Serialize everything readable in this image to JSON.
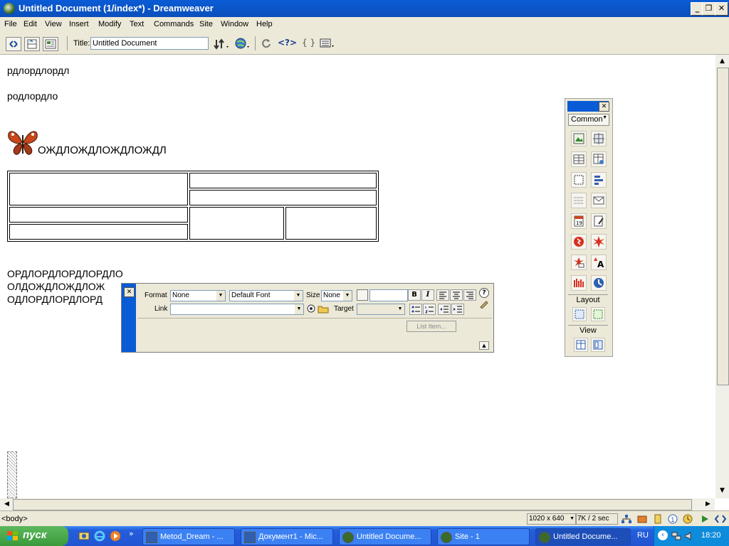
{
  "window": {
    "title": "Untitled Document (1/index*) - Dreamweaver",
    "minimize": "_",
    "restore": "❐",
    "close": "✕"
  },
  "menu": [
    "File",
    "Edit",
    "View",
    "Insert",
    "Modify",
    "Text",
    "Commands",
    "Site",
    "Window",
    "Help"
  ],
  "toolbar": {
    "title_label": "Title:",
    "title_value": "Untitled Document",
    "code_glyph": "<?>",
    "braces_glyph": "{ }"
  },
  "document": {
    "para1": "рдлордлордл",
    "para2": "родлордло",
    "heading_text": "ОЖДЛОЖДЛОЖДЛОЖДЛ",
    "para3": "ОРДЛОРДЛОРДЛОРДЛО",
    "para4": "ОЛДОЖДЛОЖДЛОЖ",
    "para5": "ОДЛОРДЛОРДЛОРД"
  },
  "objects_panel": {
    "category": "Common",
    "layout_label": "Layout",
    "view_label": "View",
    "close": "✕"
  },
  "properties": {
    "close": "✕",
    "format_label": "Format",
    "format_value": "None",
    "font_value": "Default Font",
    "size_label": "Size",
    "size_value": "None",
    "bold": "B",
    "italic": "I",
    "link_label": "Link",
    "link_value": "",
    "target_label": "Target",
    "list_item_button": "List Item...",
    "help_glyph": "?"
  },
  "status": {
    "tag": "<body>",
    "window_size": "1020 x 640",
    "download": "7K / 2 sec"
  },
  "taskbar": {
    "start_label": "пуск",
    "tasks": [
      "Metod_Dream - ...",
      "Документ1 - Mic...",
      "Untitled Docume...",
      "Site - 1",
      "Untitled Docume..."
    ],
    "language": "RU",
    "clock": "18:20",
    "overflow": "»"
  },
  "colors": {
    "titlebar": "#0a5bd6",
    "chrome": "#ece9d8",
    "taskbar": "#245edc",
    "start": "#3a9a3a"
  }
}
